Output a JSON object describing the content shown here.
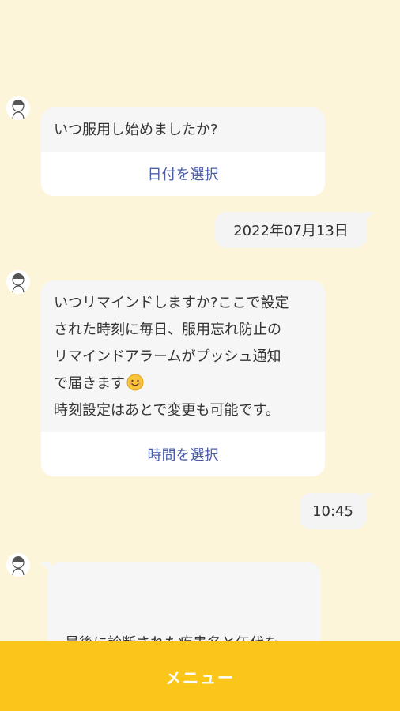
{
  "messages": {
    "q1": {
      "text": "いつ服用し始めましたか?",
      "action_label": "日付を選択"
    },
    "a1": {
      "text": "2022年07月13日"
    },
    "q2": {
      "text": "いつリマインドしますか?ここで設定\nされた時刻に毎日、服用忘れ防止の\nリマインドアラームがプッシュ通知\nで届きます",
      "emoji": "smiling-face-emoji",
      "text2": "時刻設定はあとで変更も可能です。",
      "action_label": "時間を選択"
    },
    "a2": {
      "text": "10:45"
    },
    "q3": {
      "text": "最後に診断された疾患名と年代を\n教えてください。"
    }
  },
  "menu": {
    "label": "メニュー"
  },
  "colors": {
    "background": "#fdf5d9",
    "accent_bar": "#fbc61a",
    "link": "#4c5ea8",
    "bubble": "#f6f6f6"
  },
  "icons": {
    "avatar": "assistant-avatar-icon"
  }
}
